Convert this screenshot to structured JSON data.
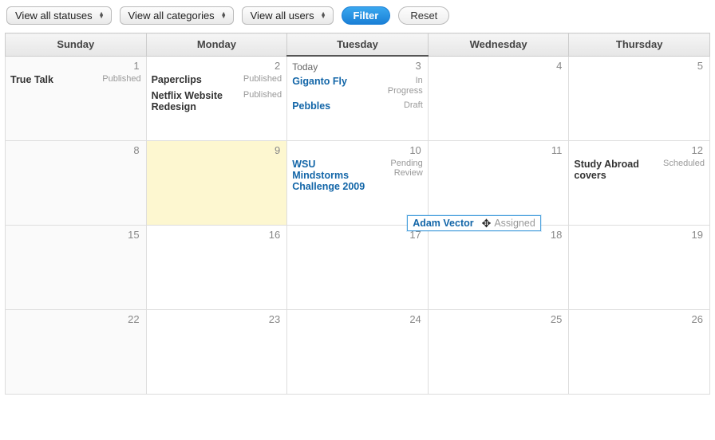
{
  "toolbar": {
    "status_select": "View all statuses",
    "category_select": "View all categories",
    "user_select": "View all users",
    "filter_btn": "Filter",
    "reset_btn": "Reset"
  },
  "calendar": {
    "headers": [
      "Sunday",
      "Monday",
      "Tuesday",
      "Wednesday",
      "Thursday"
    ],
    "today_label": "Today",
    "rows": [
      {
        "days": [
          {
            "num": "1",
            "events": [
              {
                "title": "True Talk",
                "status": "Published",
                "link": false
              }
            ]
          },
          {
            "num": "2",
            "events": [
              {
                "title": "Paperclips",
                "status": "Published",
                "link": false
              },
              {
                "title": "Netflix Website Redesign",
                "status": "Published",
                "link": false
              }
            ]
          },
          {
            "num": "3",
            "today": true,
            "events": [
              {
                "title": "Giganto Fly",
                "status": "In Progress",
                "link": true
              },
              {
                "title": "Pebbles",
                "status": "Draft",
                "link": true
              }
            ]
          },
          {
            "num": "4",
            "events": []
          },
          {
            "num": "5",
            "events": []
          }
        ]
      },
      {
        "days": [
          {
            "num": "8",
            "events": []
          },
          {
            "num": "9",
            "highlight": true,
            "events": []
          },
          {
            "num": "10",
            "events": [
              {
                "title": "WSU Mindstorms Challenge 2009",
                "status": "Pending Review",
                "link": true
              }
            ],
            "drag": {
              "title": "Adam Vector",
              "status": "Assigned"
            }
          },
          {
            "num": "11",
            "events": []
          },
          {
            "num": "12",
            "events": [
              {
                "title": "Study Abroad covers",
                "status": "Scheduled",
                "link": false
              }
            ]
          }
        ]
      },
      {
        "days": [
          {
            "num": "15",
            "events": []
          },
          {
            "num": "16",
            "events": []
          },
          {
            "num": "17",
            "events": []
          },
          {
            "num": "18",
            "events": []
          },
          {
            "num": "19",
            "events": []
          }
        ]
      },
      {
        "days": [
          {
            "num": "22",
            "events": []
          },
          {
            "num": "23",
            "events": []
          },
          {
            "num": "24",
            "events": []
          },
          {
            "num": "25",
            "events": []
          },
          {
            "num": "26",
            "events": []
          }
        ]
      }
    ]
  }
}
